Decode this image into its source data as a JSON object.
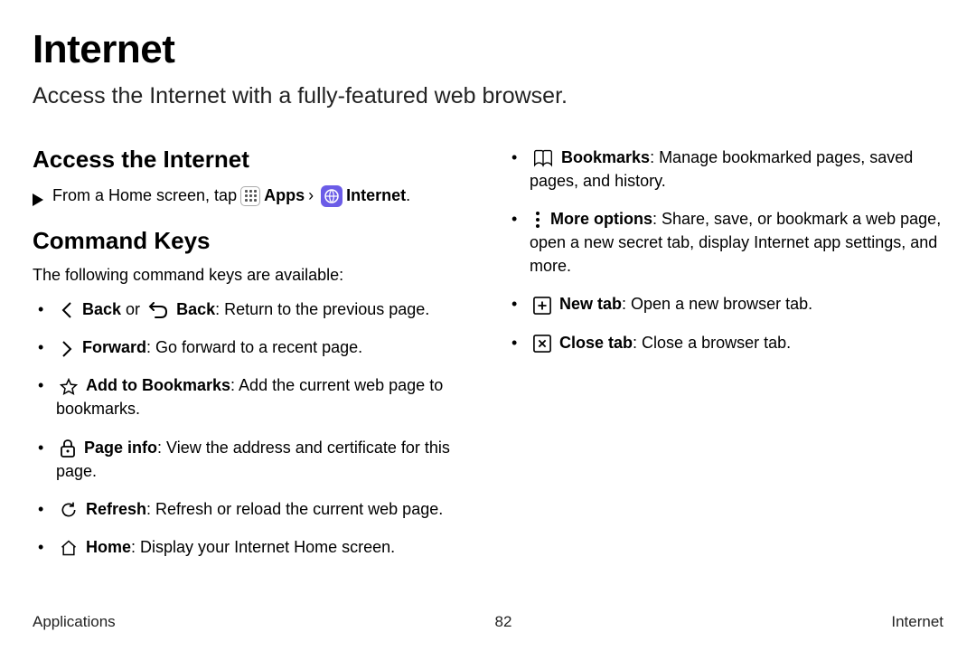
{
  "title": "Internet",
  "subtitle": "Access the Internet with a fully-featured web browser.",
  "section1_heading": "Access the Internet",
  "step_prefix": "From a Home screen, tap",
  "step_apps": "Apps",
  "step_sep": "›",
  "step_internet": "Internet",
  "step_period": ".",
  "section2_heading": "Command Keys",
  "intro": "The following command keys are available:",
  "back_bold": "Back",
  "or_text": " or ",
  "back2_bold": "Back",
  "back_desc": ": Return to the previous page.",
  "forward_bold": "Forward",
  "forward_desc": ": Go forward to a recent page.",
  "addbm_bold": "Add to Bookmarks",
  "addbm_desc": ": Add the current web page to bookmarks.",
  "pageinfo_bold": "Page info",
  "pageinfo_desc": ": View the address and certificate for this page.",
  "refresh_bold": "Refresh",
  "refresh_desc": ": Refresh or reload the current web page.",
  "home_bold": "Home",
  "home_desc": ": Display your Internet Home screen.",
  "bookmarks_bold": "Bookmarks",
  "bookmarks_desc": ": Manage bookmarked pages, saved pages, and history.",
  "more_bold": "More options",
  "more_desc": ": Share, save, or bookmark a web page, open a new secret tab, display Internet app settings, and more.",
  "newtab_bold": "New tab",
  "newtab_desc": ": Open a new browser tab.",
  "closetab_bold": "Close tab",
  "closetab_desc": ": Close a browser tab.",
  "footer_left": "Applications",
  "footer_center": "82",
  "footer_right": "Internet"
}
